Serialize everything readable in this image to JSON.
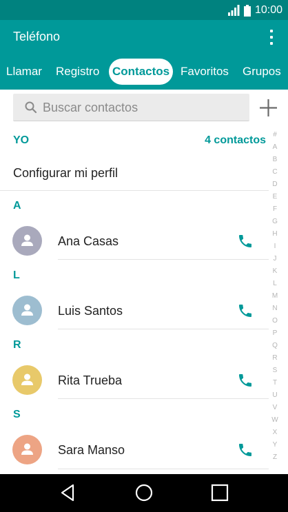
{
  "status_bar": {
    "time": "10:00",
    "icons": [
      "signal-icon",
      "battery-icon"
    ]
  },
  "app_bar": {
    "title": "Teléfono",
    "menu_icon": "overflow-menu-icon"
  },
  "tabs": [
    {
      "label": "Llamar",
      "active": false
    },
    {
      "label": "Registro",
      "active": false
    },
    {
      "label": "Contactos",
      "active": true
    },
    {
      "label": "Favoritos",
      "active": false
    },
    {
      "label": "Grupos",
      "active": false
    }
  ],
  "search": {
    "placeholder": "Buscar contactos"
  },
  "add_icon": "plus-icon",
  "me_section": {
    "header": "YO",
    "count": "4 contactos",
    "profile": "Configurar mi perfil"
  },
  "sections": [
    {
      "letter": "A",
      "contacts": [
        {
          "name": "Ana Casas",
          "avatar_color": "#a9a9bc"
        }
      ]
    },
    {
      "letter": "L",
      "contacts": [
        {
          "name": "Luis Santos",
          "avatar_color": "#9dbdd0"
        }
      ]
    },
    {
      "letter": "R",
      "contacts": [
        {
          "name": "Rita Trueba",
          "avatar_color": "#e8c96a"
        }
      ]
    },
    {
      "letter": "S",
      "contacts": [
        {
          "name": "Sara Manso",
          "avatar_color": "#eda484"
        }
      ]
    }
  ],
  "index_letters": [
    "#",
    "A",
    "B",
    "C",
    "D",
    "E",
    "F",
    "G",
    "H",
    "I",
    "J",
    "K",
    "L",
    "M",
    "N",
    "O",
    "P",
    "Q",
    "R",
    "S",
    "T",
    "U",
    "V",
    "W",
    "X",
    "Y",
    "Z"
  ],
  "colors": {
    "accent": "#009999",
    "status_bar": "#00827f",
    "call_icon": "#009999"
  },
  "nav_bar": {
    "icons": [
      "back-icon",
      "home-icon",
      "recents-icon"
    ]
  }
}
